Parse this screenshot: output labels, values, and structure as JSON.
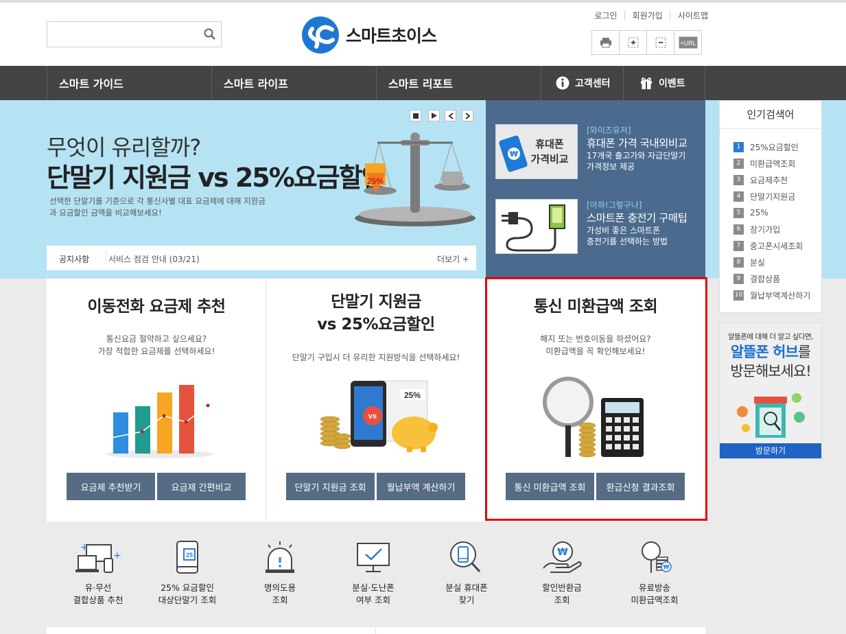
{
  "header": {
    "search": {
      "placeholder": ""
    },
    "logo_text": "스마트초이스",
    "util_links": [
      "로그인",
      "회원가입",
      "사이트맵"
    ],
    "tools": [
      "print-icon",
      "zoom-in-icon",
      "zoom-out-icon",
      "url-copy-icon"
    ],
    "tool_url_label": "+URL"
  },
  "gnb": {
    "items": [
      "스마트 가이드",
      "스마트 라이프",
      "스마트 리포트"
    ],
    "customer_center": "고객센터",
    "event": "이벤트"
  },
  "hero": {
    "subtitle": "무엇이 유리할까?",
    "title": "단말기 지원금 vs 25%요금할인",
    "description": "선택한 단말기를 기준으로 각 통신사별 대표 요금제에 대해 지원금과 요금할인 금액을 비교해보세요!",
    "badge": "25%",
    "controls": [
      "stop",
      "play",
      "prev",
      "next"
    ]
  },
  "notice": {
    "label": "공지사항",
    "text": "서비스 점검 안내 (03/21)",
    "more": "더보기 +"
  },
  "articles": [
    {
      "category": "[와이즈유저]",
      "title": "휴대폰 가격 국내외비교",
      "desc1": "17개국 출고가와 자급단말기",
      "desc2": "가격정보 제공",
      "thumb_line1": "휴대폰",
      "thumb_line2": "가격비교"
    },
    {
      "category": "[아하!그렇구나]",
      "title": "스마트폰 충전기 구매팁",
      "desc1": "가성비 좋은 스마트폰",
      "desc2": "충전기를 선택하는 방법"
    }
  ],
  "popular": {
    "title": "인기검색어",
    "items": [
      {
        "rank": "1",
        "label": "25%요금할인"
      },
      {
        "rank": "2",
        "label": "미환급액조회"
      },
      {
        "rank": "3",
        "label": "요금제추천"
      },
      {
        "rank": "4",
        "label": "단말기지원금"
      },
      {
        "rank": "5",
        "label": "25%"
      },
      {
        "rank": "6",
        "label": "장기가입"
      },
      {
        "rank": "7",
        "label": "중고폰시세조회"
      },
      {
        "rank": "8",
        "label": "분실"
      },
      {
        "rank": "9",
        "label": "결합상품"
      },
      {
        "rank": "10",
        "label": "월납부액계산하기"
      }
    ]
  },
  "ad": {
    "small": "알뜰폰에 대해 더 알고 싶다면,",
    "line1": "알뜰폰 허브",
    "line1_suffix": "를",
    "line2": "방문해보세요!",
    "button": "방문하기"
  },
  "cards": [
    {
      "title1": "이동전화 요금제 추천",
      "desc1": "통신요금 절약하고 싶으세요?",
      "desc2": "가장 적합한 요금제를 선택하세요!",
      "buttons": [
        "요금제 추천받기",
        "요금제 간편비교"
      ]
    },
    {
      "title1": "단말기 지원금",
      "title2": "vs 25%요금할인",
      "desc1": "단말기 구입시 더 유리한 지원방식을 선택하세요!",
      "badge_vs": "vs",
      "badge_pct": "25%",
      "buttons": [
        "단말기 지원금 조회",
        "월납부액 계산하기"
      ]
    },
    {
      "title1": "통신 미환급액 조회",
      "desc1": "해지 또는 번호이동을 하셨어요?",
      "desc2": "미환급액을 꼭 확인해보세요!",
      "buttons": [
        "통신 미환급액 조회",
        "환급신청 결과조회"
      ]
    }
  ],
  "quick_links": [
    {
      "line1": "유·무선",
      "line2": "결합상품 추천",
      "icon": "devices-icon"
    },
    {
      "line1": "25% 요금할인",
      "line2": "대상단말기 조회",
      "icon": "phone-25-icon",
      "icon_text": "25"
    },
    {
      "line1": "명의도용",
      "line2": "조회",
      "icon": "alarm-icon"
    },
    {
      "line1": "분실·도난폰",
      "line2": "여부 조회",
      "icon": "monitor-check-icon"
    },
    {
      "line1": "분실 휴대폰",
      "line2": "찾기",
      "icon": "magnifier-phone-icon"
    },
    {
      "line1": "할인반환금",
      "line2": "조회",
      "icon": "hand-won-icon",
      "icon_text": "₩"
    },
    {
      "line1": "유료방송",
      "line2": "미환급액조회",
      "icon": "magnifier-coins-icon"
    }
  ],
  "colors": {
    "gnb": "#444444",
    "hero": "#b5e3f4",
    "article_panel": "#4c6a8d",
    "button": "#566b84",
    "highlight": "#e40000",
    "rank_first": "#2b7bd8"
  }
}
